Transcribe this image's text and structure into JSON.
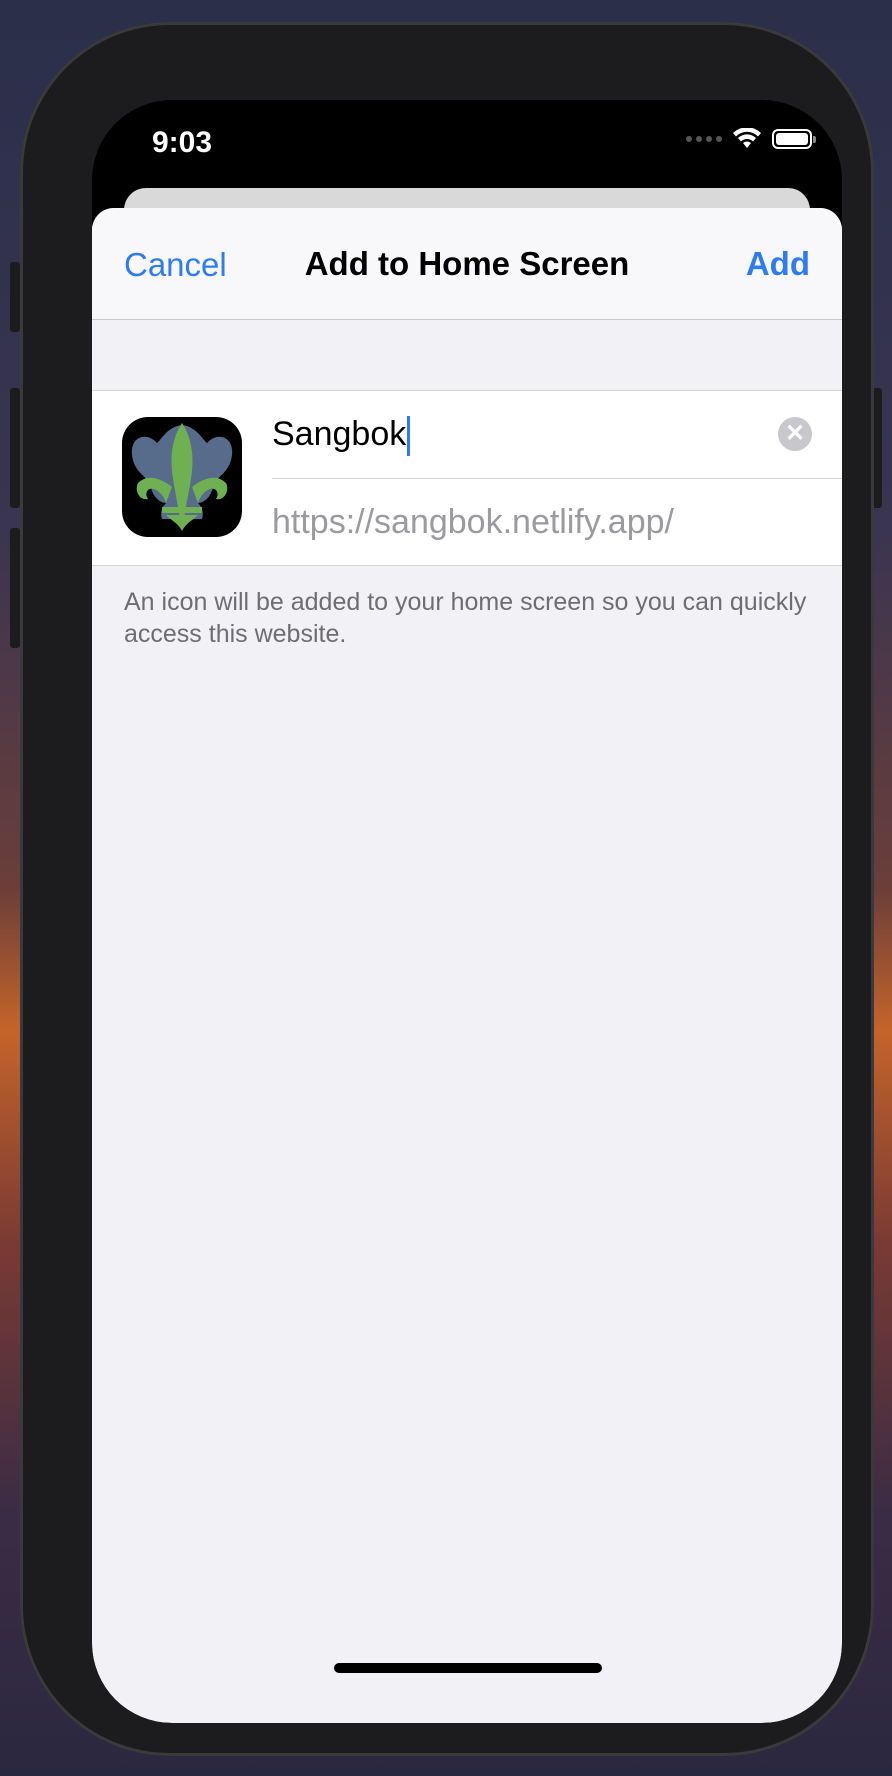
{
  "status_bar": {
    "time": "9:03"
  },
  "nav": {
    "cancel_label": "Cancel",
    "title": "Add to Home Screen",
    "add_label": "Add"
  },
  "shortcut": {
    "name_value": "Sangbok",
    "url": "https://sangbok.netlify.app/"
  },
  "hint_text": "An icon will be added to your home screen so you can quickly access this website.",
  "colors": {
    "accent": "#2f7bf5",
    "sheet_bg": "#f1f1f6"
  }
}
